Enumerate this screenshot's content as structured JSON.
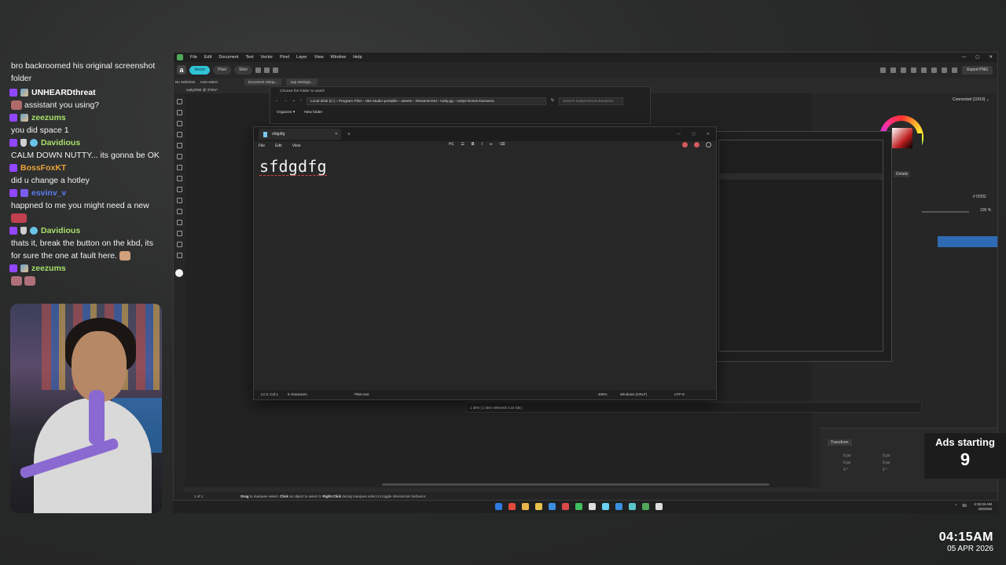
{
  "chat": {
    "intro": "bro backroomed his original screenshot folder",
    "messages": [
      {
        "user": "UNHEARDthreat",
        "color": "#ffffff",
        "text": "assistant you using?"
      },
      {
        "user": "zeezums",
        "color": "#a8e06b",
        "text": "you did space 1"
      },
      {
        "user": "Davidious",
        "color": "#a8e06b",
        "text": "CALM DOWN NUTTY... its gonna be OK"
      },
      {
        "user": "BossFoxKT",
        "color": "#e8a33c",
        "text": "did u change a hotley"
      },
      {
        "user": "esvinv_v",
        "color": "#5a7cf0",
        "text": "happned to me you might need a new"
      },
      {
        "user": "Davidious",
        "color": "#a8e06b",
        "text": "thats it, break the button on the kbd, its for sure the one at fault here."
      },
      {
        "user": "zeezums",
        "color": "#a8e06b",
        "text": ""
      }
    ]
  },
  "ads": {
    "label": "Ads starting",
    "count": "9"
  },
  "clock": {
    "time": "04:15AM",
    "date": "05 APR 2026"
  },
  "app": {
    "menu": [
      "File",
      "Edit",
      "Document",
      "Text",
      "Vector",
      "Pixel",
      "Layer",
      "View",
      "Window",
      "Help"
    ],
    "personas": [
      "Vector",
      "Pixel",
      "Slice"
    ],
    "export_label": "Export PNG",
    "context": {
      "selection": "No Selection",
      "auto_select": "Auto-select",
      "doc_setup": "Document Setup...",
      "app_settings": "App Settings..."
    },
    "doc_tab": "nuttyONE @ 375%*",
    "connected": "Connected (10/10)",
    "hex": "f2f2f2",
    "opacity": "100 %",
    "transform_tab": "Transform",
    "transform_values": [
      "0 px",
      "0 px",
      "0 px",
      "0 px",
      "0 °",
      "0 °"
    ],
    "status": {
      "page": "1 of 1",
      "hint_bold1": "Drag",
      "hint1": " to marquee select. ",
      "hint_bold2": "Click",
      "hint2": " an object to select it. ",
      "hint_bold3": "Right-Click",
      "hint3": " during marquee select to toggle intersection behavior."
    }
  },
  "explorer": {
    "title": "Choose the folder to watch",
    "breadcrumb": "Local Disk (C:)  ›  Program Files  ›  obs-studio-portable  ›  assets  ›  Streamer.bot  ›  nutty.gg  ›  nuttys-bonus-bonanza",
    "search_placeholder": "Search nuttys-bonus-bonanza",
    "organize": "Organize ▾",
    "new_folder": "New folder",
    "details": "Details",
    "status": "1 item  |  1 item selected  4.15 GB  |"
  },
  "notepad": {
    "tab_title": "sfdgdfg",
    "menu": [
      "File",
      "Edit",
      "View"
    ],
    "heading": "H1",
    "content": "sfdgdfg",
    "status": {
      "position": "Ln 3, Col 1",
      "chars": "9 characters",
      "format": "Plain text",
      "zoom": "400%",
      "line_ending": "Windows (CRLF)",
      "encoding": "UTF-8"
    }
  },
  "taskbar": {
    "icon_colors": [
      "#2d7be0",
      "#e24a3a",
      "#e9b44c",
      "#e9c24c",
      "#3a8ee0",
      "#d84a4a",
      "#3fbf5f",
      "#ddd",
      "#6ad0f0",
      "#3a8ee0",
      "#5ac5c8",
      "#4fa75a",
      "#ddd"
    ],
    "tray_count": "66",
    "sys_time": "4:15:34 AM",
    "sys_date": "4/5/2026"
  }
}
